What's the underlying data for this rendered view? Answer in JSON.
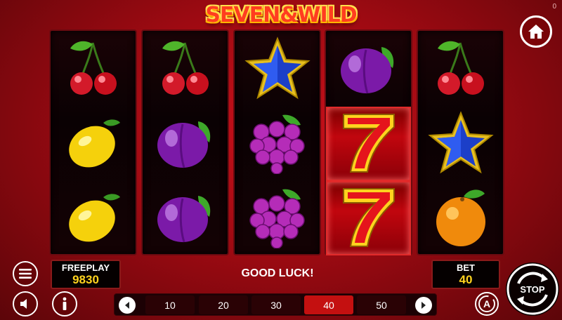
{
  "counter": "0",
  "title": "SEVEN&WILD",
  "reels": [
    [
      "cherry-icon",
      "lemon-icon",
      "lemon-icon"
    ],
    [
      "cherry-icon",
      "plum-icon",
      "plum-icon"
    ],
    [
      "star-icon",
      "grapes-icon",
      "grapes-icon"
    ],
    [
      "plum-icon",
      "seven-icon",
      "seven-icon"
    ],
    [
      "cherry-icon",
      "star-icon",
      "orange-icon"
    ]
  ],
  "freeplay": {
    "label": "FREEPLAY",
    "value": "9830"
  },
  "bet": {
    "label": "BET",
    "value": "40"
  },
  "message": "GOOD LUCK!",
  "bet_options": [
    "10",
    "20",
    "30",
    "40",
    "50"
  ],
  "selected_bet": "40",
  "stop_label": "STOP",
  "auto_label": "A",
  "colors": {
    "accent": "#c41010",
    "value": "#ffd31e"
  }
}
